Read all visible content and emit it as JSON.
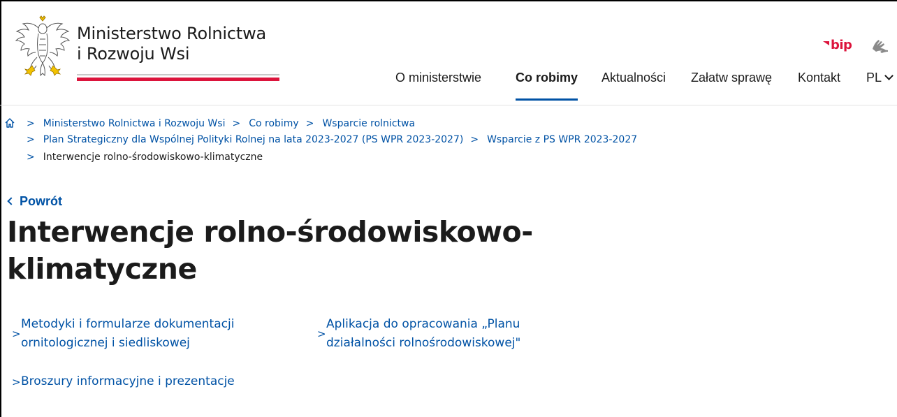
{
  "header": {
    "site_name_line1": "Ministerstwo Rolnictwa",
    "site_name_line2": "i Rozwoju Wsi",
    "bip": "bip"
  },
  "nav": {
    "items": [
      {
        "label": "O ministerstwie",
        "active": false
      },
      {
        "label": "Co robimy",
        "active": true
      },
      {
        "label": "Aktualności",
        "active": false
      },
      {
        "label": "Załatw sprawę",
        "active": false
      },
      {
        "label": "Kontakt",
        "active": false
      }
    ],
    "language": "PL"
  },
  "breadcrumbs": {
    "items": [
      "Ministerstwo Rolnictwa i Rozwoju Wsi",
      "Co robimy",
      "Wsparcie rolnictwa",
      "Plan Strategiczny dla Wspólnej Polityki Rolnej na lata 2023-2027 (PS WPR 2023-2027)",
      "Wsparcie z PS WPR 2023-2027"
    ],
    "current": "Interwencje rolno-środowiskowo-klimatyczne",
    "separator": ">"
  },
  "back_label": "Powrót",
  "page_title_line1": "Interwencje rolno-środowiskowo-",
  "page_title_line2": "klimatyczne",
  "links": [
    {
      "line1": "Metodyki i formularze dokumentacji",
      "line2": "ornitologicznej i siedliskowej"
    },
    {
      "line1": "Aplikacja do opracowania „Planu",
      "line2": "działalności rolnośrodowiskowej\""
    },
    {
      "line1": "Broszury informacyjne i prezentacje",
      "line2": ""
    }
  ],
  "colors": {
    "accent": "#0052a5",
    "flag_red": "#dc143c",
    "text": "#1b1b1b"
  }
}
